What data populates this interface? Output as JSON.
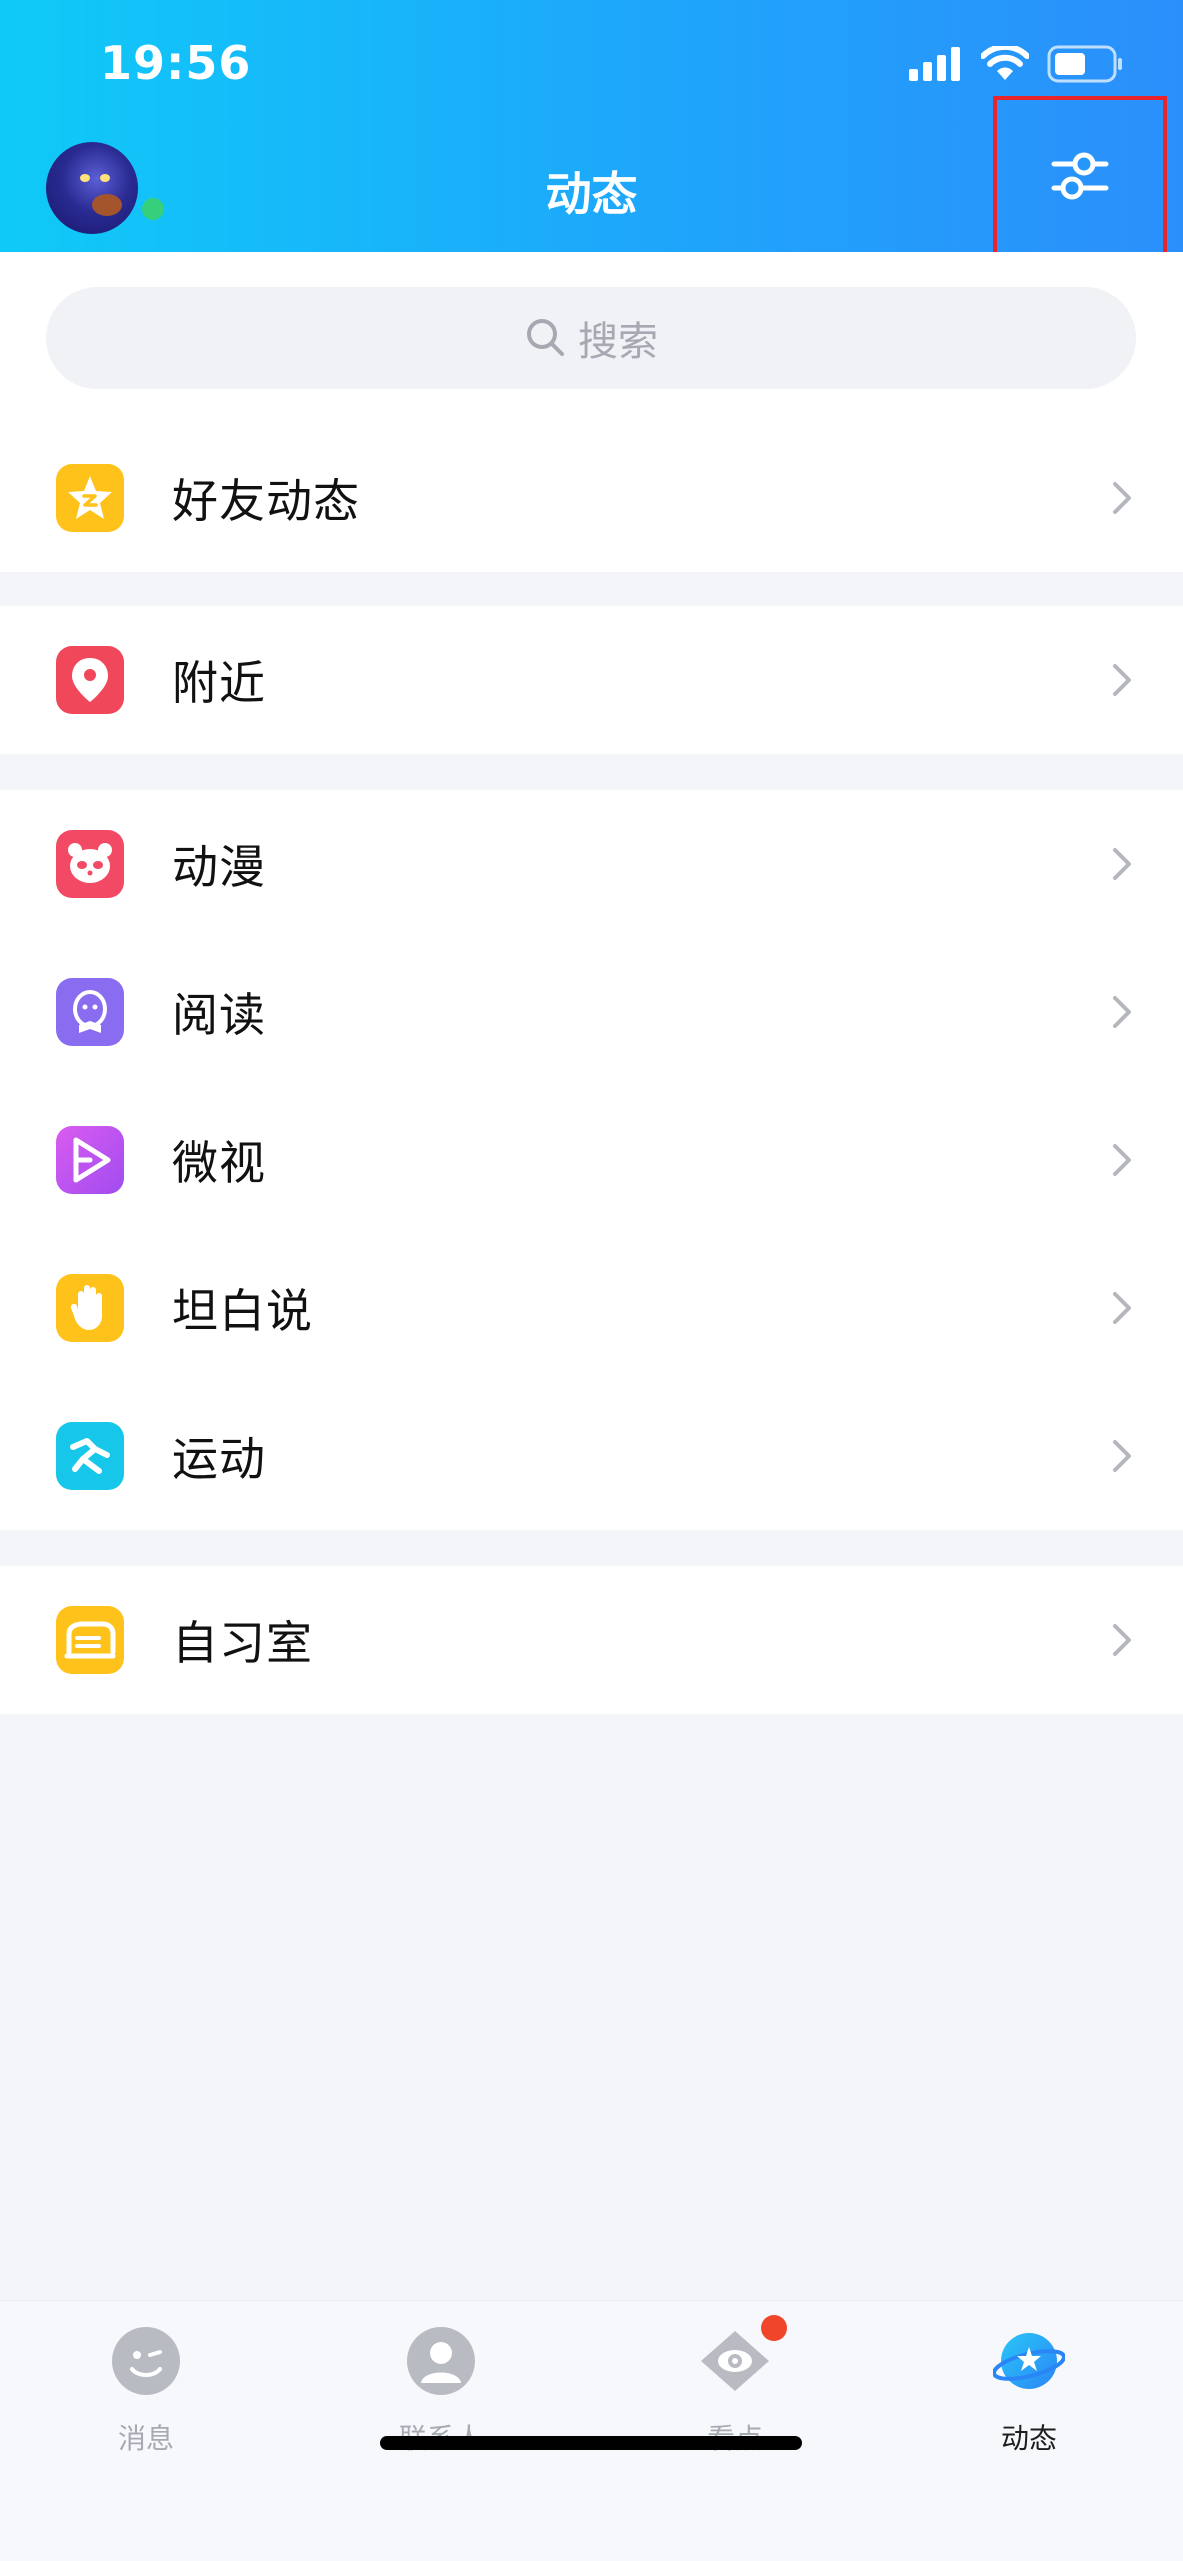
{
  "status_bar": {
    "time": "19:56"
  },
  "header": {
    "title": "动态",
    "settings_icon": "sliders-icon"
  },
  "search": {
    "placeholder": "搜索"
  },
  "sections": [
    {
      "items": [
        {
          "label": "好友动态",
          "icon": "star-icon",
          "color": "#ffc21a"
        }
      ]
    },
    {
      "items": [
        {
          "label": "附近",
          "icon": "location-pin-icon",
          "color": "#f0485a"
        }
      ]
    },
    {
      "items": [
        {
          "label": "动漫",
          "icon": "panda-icon",
          "color": "#f24a64"
        },
        {
          "label": "阅读",
          "icon": "penguin-book-icon",
          "color": "#8a6cf0"
        },
        {
          "label": "微视",
          "icon": "play-icon",
          "color": "#c456ee"
        },
        {
          "label": "坦白说",
          "icon": "hand-icon",
          "color": "#ffc21a"
        },
        {
          "label": "运动",
          "icon": "running-icon",
          "color": "#17c7ea"
        }
      ]
    },
    {
      "items": [
        {
          "label": "自习室",
          "icon": "study-room-icon",
          "color": "#ffc21a"
        }
      ]
    }
  ],
  "tabbar": {
    "tabs": [
      {
        "label": "消息",
        "icon": "message-icon",
        "active": false
      },
      {
        "label": "联系人",
        "icon": "contacts-icon",
        "active": false
      },
      {
        "label": "看点",
        "icon": "eye-icon",
        "active": false,
        "badge": true
      },
      {
        "label": "动态",
        "icon": "planet-icon",
        "active": true
      }
    ]
  },
  "colors": {
    "header_gradient_start": "#0fcaf8",
    "header_gradient_end": "#2b8ffb",
    "highlight_box": "#e8242c"
  }
}
